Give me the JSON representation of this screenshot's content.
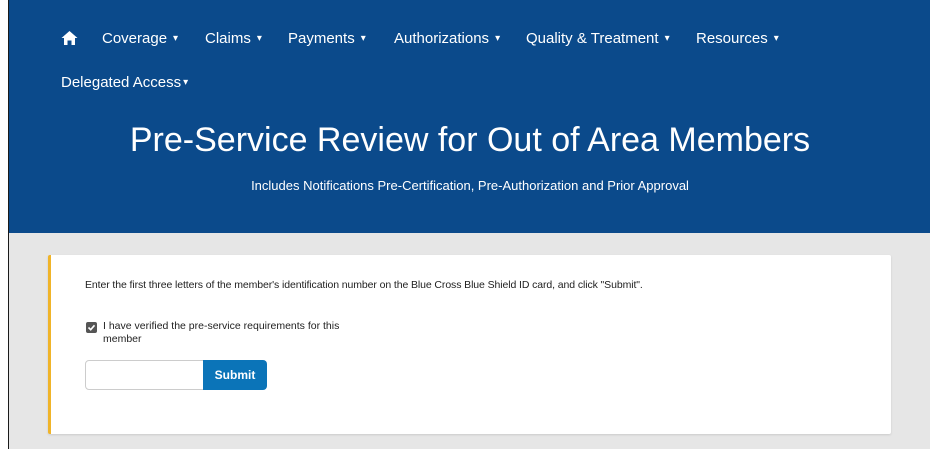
{
  "nav": {
    "home_icon": "home-icon",
    "items": [
      {
        "label": "Coverage"
      },
      {
        "label": "Claims"
      },
      {
        "label": "Payments"
      },
      {
        "label": "Authorizations"
      },
      {
        "label": "Quality & Treatment"
      },
      {
        "label": "Resources"
      }
    ],
    "second_row": {
      "label": "Delegated Access"
    },
    "caret": "▾"
  },
  "header": {
    "title": "Pre-Service Review for Out of Area Members",
    "subtitle": "Includes Notifications Pre-Certification, Pre-Authorization and Prior Approval"
  },
  "form": {
    "instructions": "Enter the first three letters of the member's identification number on the Blue Cross Blue Shield ID card, and click \"Submit\".",
    "checkbox_label": "I have verified the pre-service requirements for this member",
    "checkbox_checked": true,
    "input_value": "",
    "input_placeholder": "",
    "submit_label": "Submit"
  },
  "colors": {
    "header_bg": "#0b4a8b",
    "accent": "#f0b429",
    "button": "#0b74b8",
    "content_bg": "#e6e6e6"
  }
}
